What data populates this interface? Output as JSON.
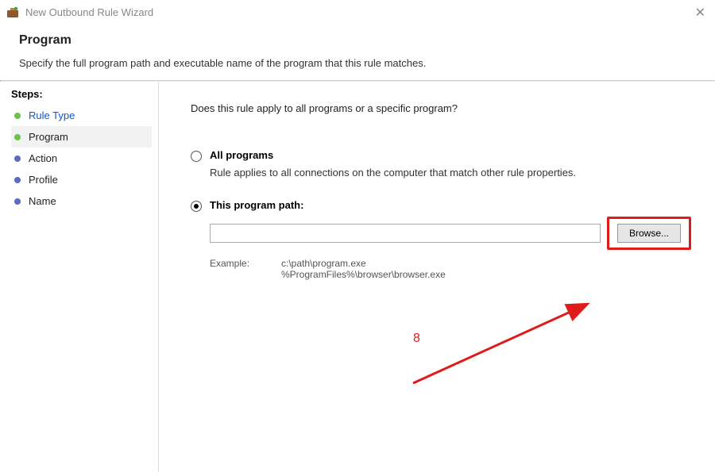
{
  "titlebar": {
    "title": "New Outbound Rule Wizard"
  },
  "header": {
    "heading": "Program",
    "subtitle": "Specify the full program path and executable name of the program that this rule matches."
  },
  "sidebar": {
    "steps_label": "Steps:",
    "items": [
      {
        "label": "Rule Type",
        "bullet": "green",
        "state": "active"
      },
      {
        "label": "Program",
        "bullet": "green",
        "state": "current"
      },
      {
        "label": "Action",
        "bullet": "blue",
        "state": ""
      },
      {
        "label": "Profile",
        "bullet": "blue",
        "state": ""
      },
      {
        "label": "Name",
        "bullet": "blue",
        "state": ""
      }
    ]
  },
  "main": {
    "question": "Does this rule apply to all programs or a specific program?",
    "option_all": {
      "label": "All programs",
      "desc": "Rule applies to all connections on the computer that match other rule properties."
    },
    "option_path": {
      "label": "This program path:",
      "value": "",
      "browse_label": "Browse...",
      "example_label": "Example:",
      "example_text": "c:\\path\\program.exe\n%ProgramFiles%\\browser\\browser.exe"
    },
    "annotation_number": "8"
  }
}
